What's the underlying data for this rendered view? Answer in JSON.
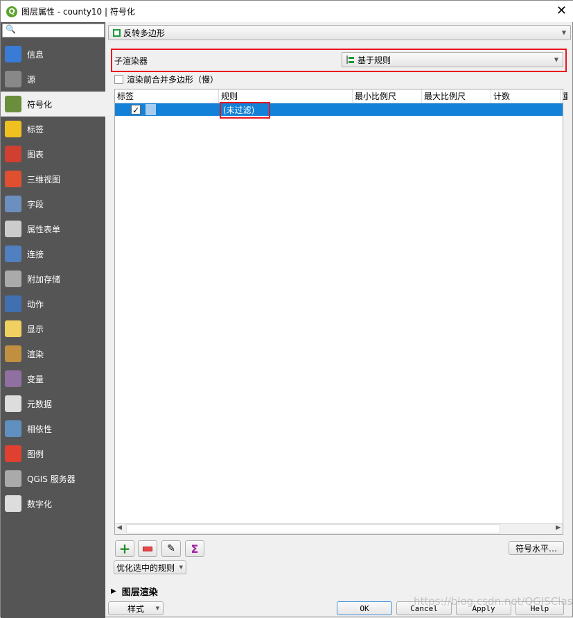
{
  "window": {
    "title": "图层属性 - county10 | 符号化",
    "close_icon": "close-icon"
  },
  "sidebar": {
    "search_placeholder": "",
    "items": [
      {
        "label": "信息",
        "icon": "info-icon",
        "color": "#3a7bd5"
      },
      {
        "label": "源",
        "icon": "source-icon",
        "color": "#888888"
      },
      {
        "label": "符号化",
        "icon": "symbology-icon",
        "color": "#6a8f3c",
        "selected": true
      },
      {
        "label": "标签",
        "icon": "labels-icon",
        "color": "#f0c020"
      },
      {
        "label": "图表",
        "icon": "diagram-icon",
        "color": "#d04030"
      },
      {
        "label": "三维视图",
        "icon": "3d-view-icon",
        "color": "#e05030"
      },
      {
        "label": "字段",
        "icon": "fields-icon",
        "color": "#6d8fc0"
      },
      {
        "label": "属性表单",
        "icon": "attributes-form-icon",
        "color": "#cccccc"
      },
      {
        "label": "连接",
        "icon": "joins-icon",
        "color": "#5080c0"
      },
      {
        "label": "附加存储",
        "icon": "auxiliary-storage-icon",
        "color": "#aaaaaa"
      },
      {
        "label": "动作",
        "icon": "actions-icon",
        "color": "#4070b0"
      },
      {
        "label": "显示",
        "icon": "display-icon",
        "color": "#f0d060"
      },
      {
        "label": "渲染",
        "icon": "rendering-icon",
        "color": "#c09040"
      },
      {
        "label": "变量",
        "icon": "variables-icon",
        "color": "#9070a0"
      },
      {
        "label": "元数据",
        "icon": "metadata-icon",
        "color": "#dddddd"
      },
      {
        "label": "相依性",
        "icon": "dependencies-icon",
        "color": "#6090c0"
      },
      {
        "label": "图例",
        "icon": "legend-icon",
        "color": "#e04030"
      },
      {
        "label": "QGIS 服务器",
        "icon": "qgis-server-icon",
        "color": "#aaaaaa"
      },
      {
        "label": "数字化",
        "icon": "digitizing-icon",
        "color": "#dddddd"
      }
    ]
  },
  "renderer": {
    "value": "反转多边形",
    "icon": "inverted-polygon-icon"
  },
  "sub_renderer": {
    "label": "子渲染器",
    "value": "基于规则",
    "icon": "rule-based-icon"
  },
  "merge_checkbox": {
    "label": "渲染前合并多边形（慢）",
    "checked": false
  },
  "table": {
    "columns": [
      "标签",
      "规则",
      "最小比例尺",
      "最大比例尺",
      "计数",
      "重"
    ],
    "rows": [
      {
        "checked": true,
        "rule": "(未过滤)",
        "swatch": "#a6cdf0"
      }
    ]
  },
  "tools": {
    "add": "add-rule-icon",
    "remove": "remove-rule-icon",
    "edit": "edit-rule-icon",
    "sum": "Σ",
    "symbol_levels": "符号水平…",
    "refine": "优化选中的规则"
  },
  "layer_rendering": "图层渲染",
  "footer": {
    "style": "样式",
    "ok": "OK",
    "cancel": "Cancel",
    "apply": "Apply",
    "help": "Help"
  },
  "watermark": "https://blog.csdn.net/QGISClass",
  "accent": "#1481d8"
}
